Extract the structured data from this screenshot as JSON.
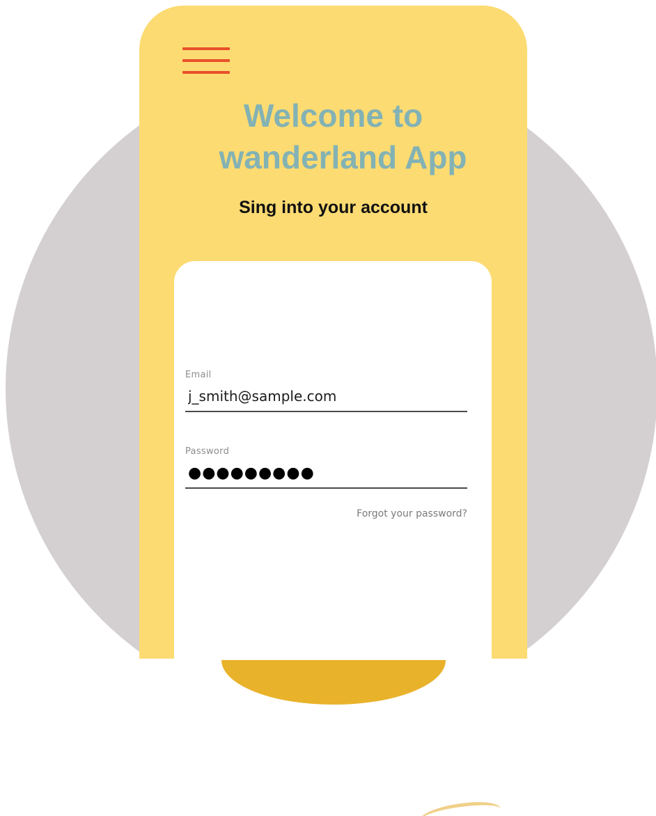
{
  "app": {
    "title_line1": "Welcome to",
    "title_line2": "wanderland App",
    "subtitle": "Sing into your account"
  },
  "form": {
    "email": {
      "label": "Email",
      "value": "j_smith@sample.com"
    },
    "password": {
      "label": "Password",
      "value": "●●●●●●●●●"
    },
    "forgot_link": "Forgot your password?"
  },
  "icons": {
    "menu": "hamburger-menu-icon"
  },
  "colors": {
    "phone_background": "#fcdb72",
    "title": "#83b2b4",
    "menu_icon": "#e8502a",
    "backdrop_circle": "#d4d0d1",
    "card": "#ffffff"
  }
}
